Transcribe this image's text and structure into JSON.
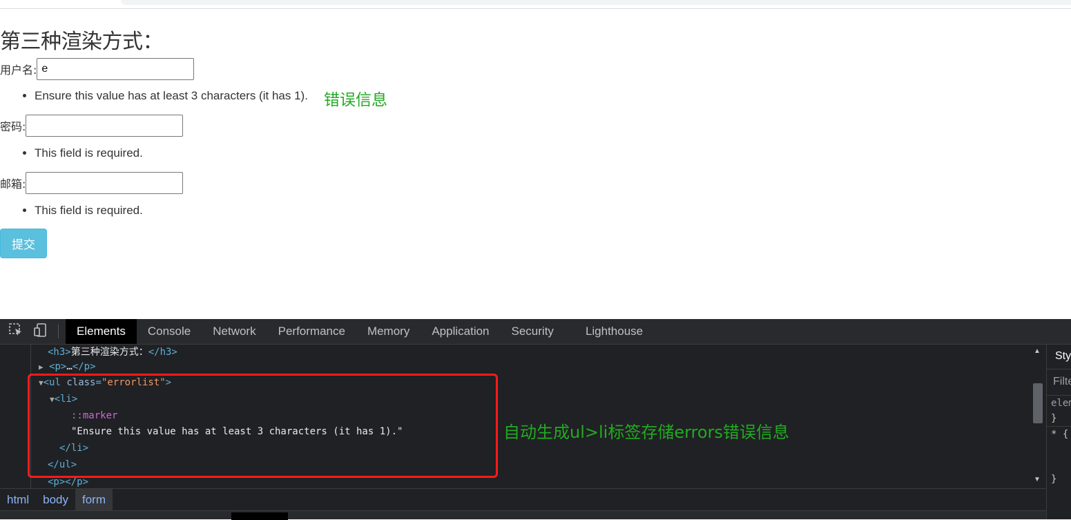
{
  "page": {
    "heading": "第三种渲染方式：",
    "fields": [
      {
        "label": "用户名:",
        "value": "e",
        "placeholder": ""
      },
      {
        "label": "密码:",
        "value": "",
        "placeholder": ""
      },
      {
        "label": "邮箱:",
        "value": "",
        "placeholder": ""
      }
    ],
    "errors": [
      "Ensure this value has at least 3 characters (it has 1).",
      "This field is required.",
      "This field is required."
    ],
    "error_annotation": "错误信息",
    "submit_label": "提交"
  },
  "devtools": {
    "tabs": [
      "Elements",
      "Console",
      "Network",
      "Performance",
      "Memory",
      "Application",
      "Security",
      "Lighthouse"
    ],
    "active_tab": "Elements",
    "dom": {
      "h3_text": "第三种渲染方式：",
      "p_ellipsis": "…",
      "ul_class": "errorlist",
      "marker": "::marker",
      "li_text": "\"Ensure this value has at least 3 characters (it has 1).\""
    },
    "annotation": "自动生成ul>li标签存储errors错误信息",
    "breadcrumbs": [
      "html",
      "body",
      "form"
    ],
    "active_breadcrumb": "form",
    "styles_pane": {
      "header": "Styles",
      "filter_placeholder": "Filter",
      "lines": [
        "element.style {",
        "}",
        "* {",
        "}"
      ]
    }
  },
  "colors": {
    "annotation_green": "#22aa22",
    "highlight_red": "#ff1a1a",
    "submit_button": "#5bc0de",
    "devtools_bg": "#202124"
  }
}
